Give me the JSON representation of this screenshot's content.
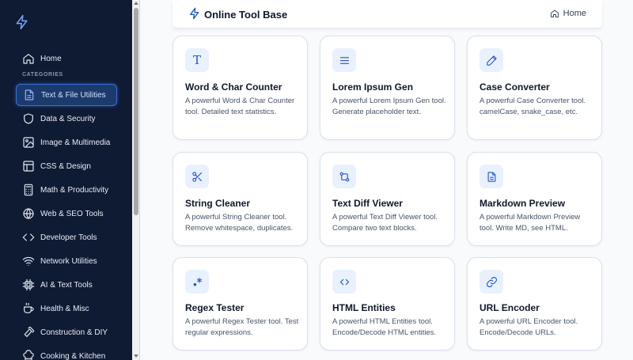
{
  "header": {
    "title": "Online Tool Base",
    "home_label": "Home"
  },
  "sidebar": {
    "home_label": "Home",
    "categories_heading": "CATEGORIES",
    "items": [
      {
        "label": "Text & File Utilities",
        "icon": "file-text-icon"
      },
      {
        "label": "Data & Security",
        "icon": "shield-icon"
      },
      {
        "label": "Image & Multimedia",
        "icon": "image-icon"
      },
      {
        "label": "CSS & Design",
        "icon": "layout-icon"
      },
      {
        "label": "Math & Productivity",
        "icon": "calculator-icon"
      },
      {
        "label": "Web & SEO Tools",
        "icon": "globe-icon"
      },
      {
        "label": "Developer Tools",
        "icon": "code-icon"
      },
      {
        "label": "Network Utilities",
        "icon": "wifi-icon"
      },
      {
        "label": "AI & Text Tools",
        "icon": "cpu-icon"
      },
      {
        "label": "Health & Misc",
        "icon": "coffee-icon"
      },
      {
        "label": "Construction & DIY",
        "icon": "hammer-icon"
      },
      {
        "label": "Cooking & Kitchen",
        "icon": "chef-hat-icon"
      }
    ]
  },
  "cards": [
    {
      "title": "Word & Char Counter",
      "desc": "A powerful Word & Char Counter tool. Detailed text statistics.",
      "icon": "type-icon"
    },
    {
      "title": "Lorem Ipsum Gen",
      "desc": "A powerful Lorem Ipsum Gen tool. Generate placeholder text.",
      "icon": "menu-icon"
    },
    {
      "title": "Case Converter",
      "desc": "A powerful Case Converter tool. camelCase, snake_case, etc.",
      "icon": "pen-icon"
    },
    {
      "title": "String Cleaner",
      "desc": "A powerful String Cleaner tool. Remove whitespace, duplicates.",
      "icon": "scissors-icon"
    },
    {
      "title": "Text Diff Viewer",
      "desc": "A powerful Text Diff Viewer tool. Compare two text blocks.",
      "icon": "git-compare-icon"
    },
    {
      "title": "Markdown Preview",
      "desc": "A powerful Markdown Preview tool. Write MD, see HTML.",
      "icon": "file-icon"
    },
    {
      "title": "Regex Tester",
      "desc": "A powerful Regex Tester tool. Test regular expressions.",
      "icon": "regex-icon"
    },
    {
      "title": "HTML Entities",
      "desc": "A powerful HTML Entities tool. Encode/Decode HTML entities.",
      "icon": "code-icon"
    },
    {
      "title": "URL Encoder",
      "desc": "A powerful URL Encoder tool. Encode/Decode URLs.",
      "icon": "link-icon"
    }
  ],
  "colors": {
    "sidebar_bg": "#0f1a33",
    "accent": "#2456c7",
    "active_bg": "#1c3a6b"
  }
}
